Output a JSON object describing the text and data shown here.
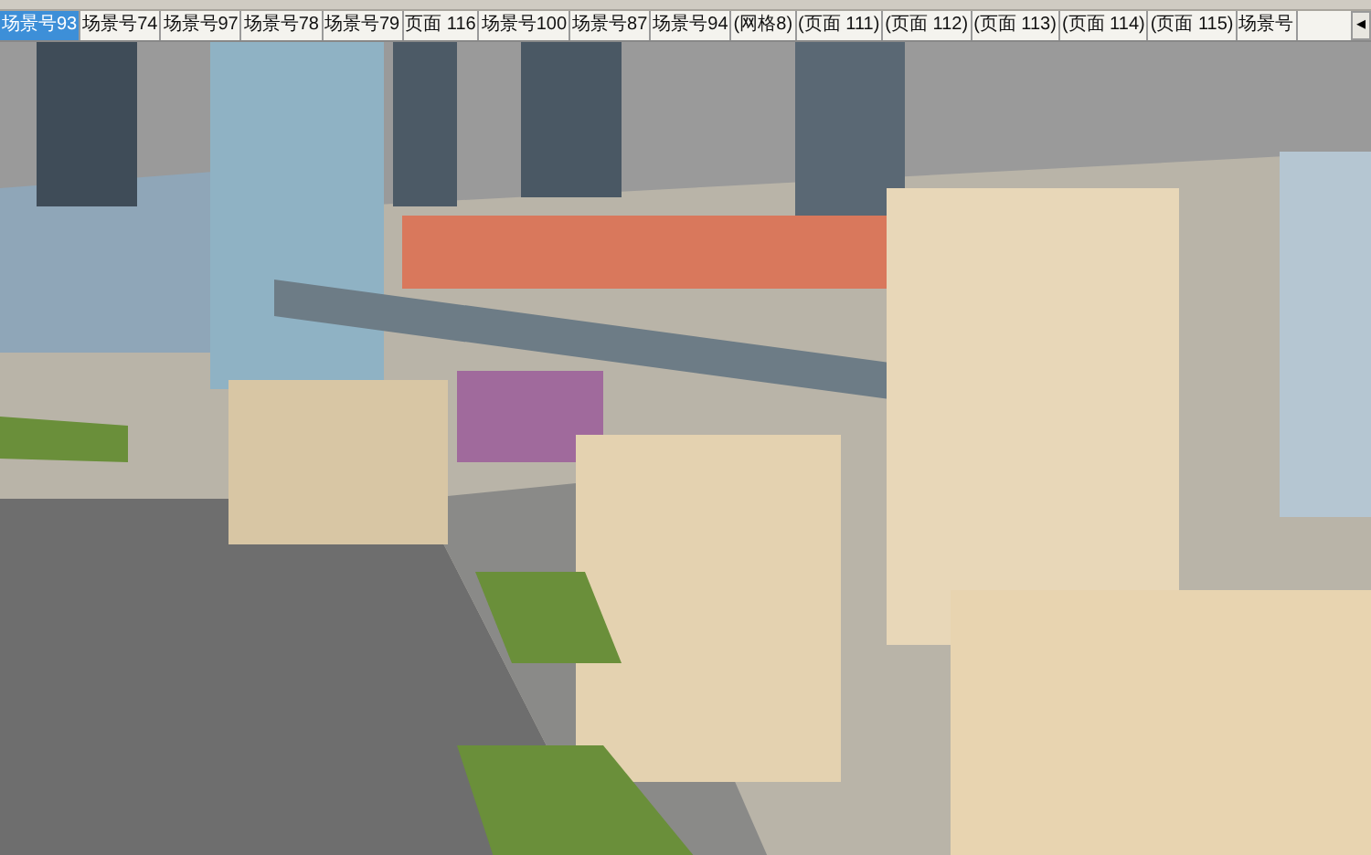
{
  "scene_tabs": [
    {
      "label": "场景号93",
      "selected": true
    },
    {
      "label": "场景号74",
      "selected": false
    },
    {
      "label": "场景号97",
      "selected": false
    },
    {
      "label": "场景号78",
      "selected": false
    },
    {
      "label": "场景号79",
      "selected": false
    },
    {
      "label": "页面 116",
      "selected": false
    },
    {
      "label": "场景号100",
      "selected": false
    },
    {
      "label": "场景号87",
      "selected": false
    },
    {
      "label": "场景号94",
      "selected": false
    },
    {
      "label": "(网格8)",
      "selected": false
    },
    {
      "label": "(页面 111)",
      "selected": false
    },
    {
      "label": "(页面 112)",
      "selected": false
    },
    {
      "label": "(页面 113)",
      "selected": false
    },
    {
      "label": "(页面 114)",
      "selected": false
    },
    {
      "label": "(页面 115)",
      "selected": false
    },
    {
      "label": "场景号",
      "selected": false
    }
  ],
  "tab_scroll": "◂"
}
